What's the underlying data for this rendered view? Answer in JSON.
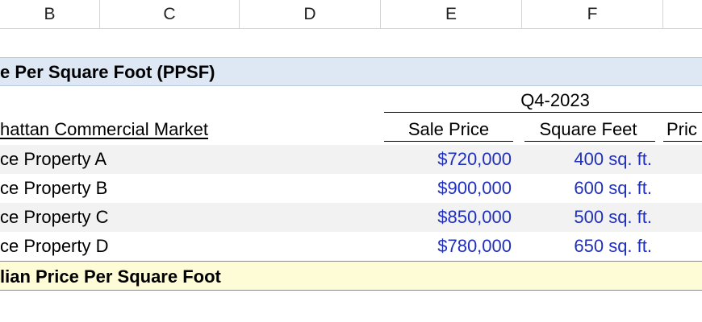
{
  "columns": [
    {
      "letter": "B"
    },
    {
      "letter": "C"
    },
    {
      "letter": "D"
    },
    {
      "letter": "E"
    },
    {
      "letter": "F"
    }
  ],
  "title": "e Per Square Foot (PPSF)",
  "period": "Q4-2023",
  "headers": {
    "market": "hattan Commercial Market",
    "sale_price": "Sale Price",
    "square_feet": "Square Feet",
    "price_partial": "Pric"
  },
  "rows": [
    {
      "name": "ce Property A",
      "sale_price": "$720,000",
      "square_feet": "400 sq. ft."
    },
    {
      "name": "ce Property B",
      "sale_price": "$900,000",
      "square_feet": "600 sq. ft."
    },
    {
      "name": "ce Property C",
      "sale_price": "$850,000",
      "square_feet": "500 sq. ft."
    },
    {
      "name": "ce Property D",
      "sale_price": "$780,000",
      "square_feet": "650 sq. ft."
    }
  ],
  "median_label": "lian Price Per Square Foot",
  "colors": {
    "title_band": "#dde8f4",
    "median_band": "#fefcd7",
    "input_blue": "#1f2fbf",
    "shaded_row": "#f2f2f2"
  }
}
